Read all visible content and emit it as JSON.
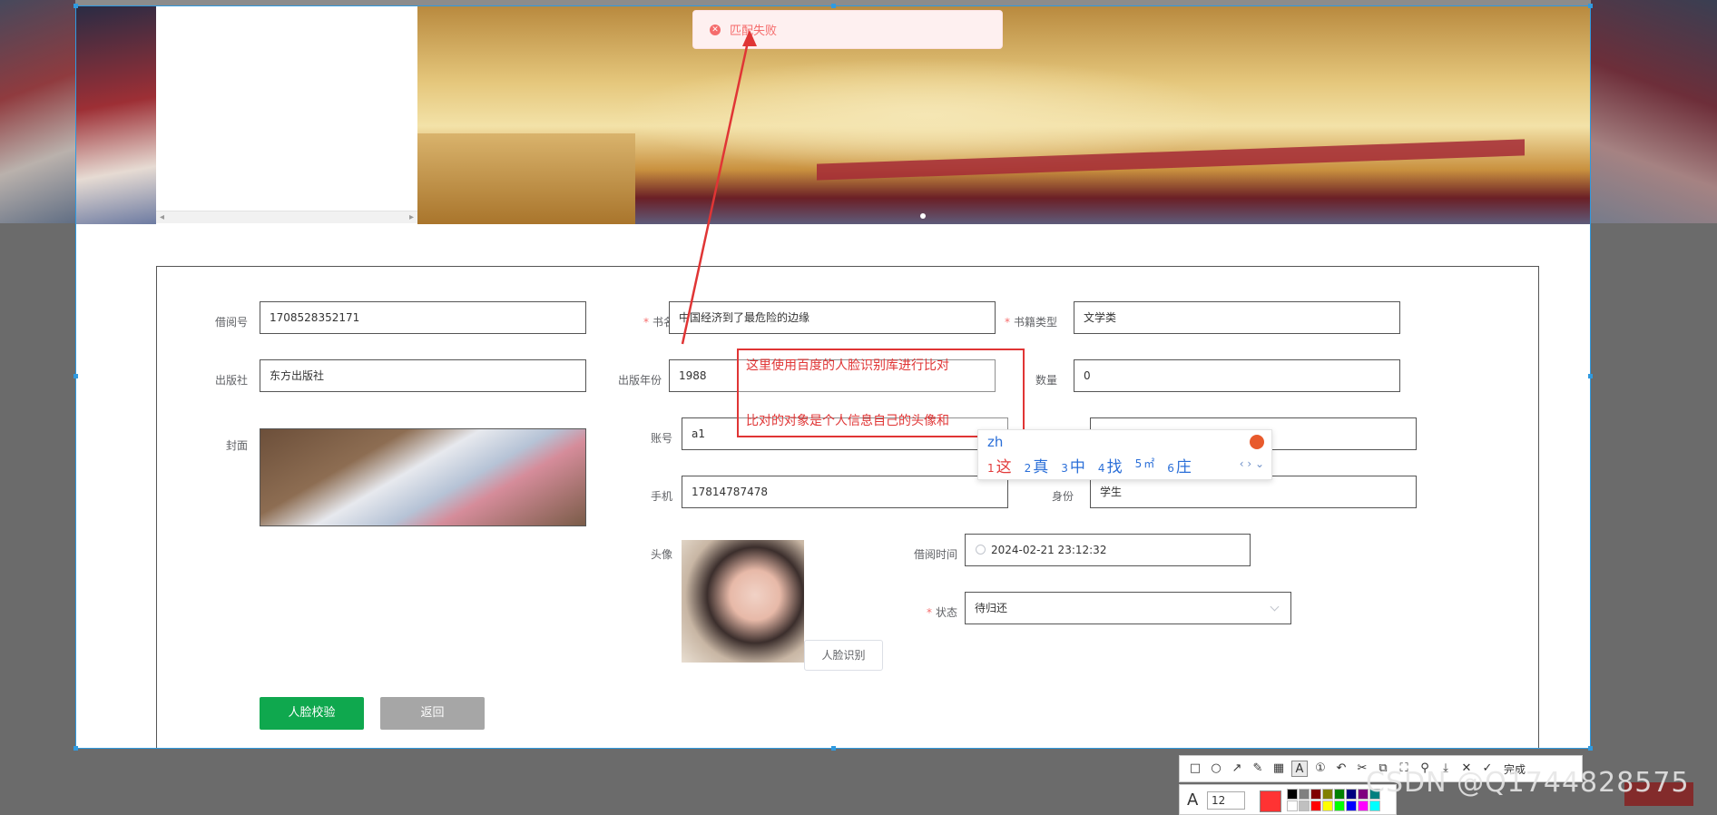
{
  "toast": {
    "message": "匹配失败"
  },
  "form": {
    "borrow_no": {
      "label": "借阅号",
      "value": "1708528352171"
    },
    "book_name": {
      "label": "书名",
      "value": "中国经济到了最危险的边缘"
    },
    "book_type": {
      "label": "书籍类型",
      "value": "文学类"
    },
    "publisher": {
      "label": "出版社",
      "value": "东方出版社"
    },
    "publish_year": {
      "label": "出版年份",
      "value": "1988"
    },
    "quantity": {
      "label": "数量",
      "value": "0"
    },
    "cover": {
      "label": "封面"
    },
    "account": {
      "label": "账号",
      "value": "a1"
    },
    "phone": {
      "label": "手机",
      "value": "17814787478"
    },
    "identity": {
      "label": "身份",
      "value": "学生"
    },
    "avatar": {
      "label": "头像"
    },
    "face_recognize_button": "人脸识别",
    "borrow_time": {
      "label": "借阅时间",
      "value": "2024-02-21 23:12:32"
    },
    "status": {
      "label": "状态",
      "value": "待归还"
    },
    "verify_button": "人脸校验",
    "back_button": "返回"
  },
  "annotation": {
    "line1": "这里使用百度的人脸识别库进行比对",
    "line2": "比对的对象是个人信息自己的头像和"
  },
  "ime": {
    "composition": "zh",
    "candidates": [
      {
        "num": "1",
        "text": "这"
      },
      {
        "num": "2",
        "text": "真"
      },
      {
        "num": "3",
        "text": "中"
      },
      {
        "num": "4",
        "text": "找"
      },
      {
        "num": "5",
        "text": "㎡"
      },
      {
        "num": "6",
        "text": "庄"
      }
    ],
    "nav": "‹ › ⌄"
  },
  "toolbar": {
    "done_label": "完成",
    "font_size": "12",
    "current_color": "#ff3333",
    "palette": [
      "#000000",
      "#808080",
      "#800000",
      "#808000",
      "#008000",
      "#000080",
      "#800080",
      "#008080",
      "#ffffff",
      "#c0c0c0",
      "#ff0000",
      "#ffff00",
      "#00ff00",
      "#0000ff",
      "#ff00ff",
      "#00ffff"
    ]
  },
  "watermark": "CSDN @Q1744828575"
}
